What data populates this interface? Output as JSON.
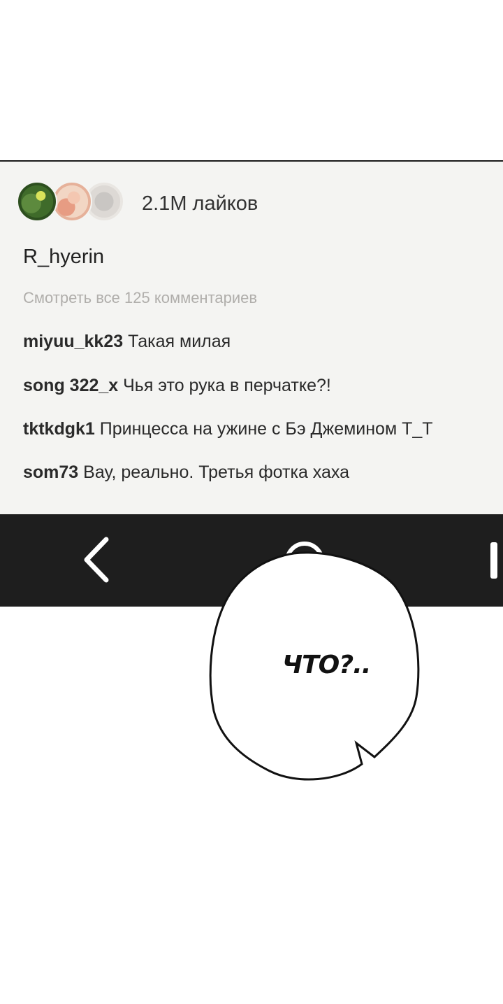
{
  "post": {
    "likes": "2.1M лайков",
    "username": "R_hyerin",
    "view_comments": "Смотреть все 125 комментариев",
    "comments": [
      {
        "author": "miyuu_kk23",
        "text": "Такая милая"
      },
      {
        "author": "song 322_x",
        "text": "Чья это рука в перчатке?!"
      },
      {
        "author": "tktkdgk1",
        "text": "Принцесса на ужине с Бэ Джемином Т_Т"
      },
      {
        "author": "som73",
        "text": "Вау, реально. Третья фотка хаха"
      }
    ]
  },
  "nav": {
    "back_icon": "chevron-left-icon",
    "home_icon": "circle-home-icon",
    "recent_icon": "bar-recent-icon"
  },
  "speech_bubble": {
    "text": "ЧТО?.."
  }
}
